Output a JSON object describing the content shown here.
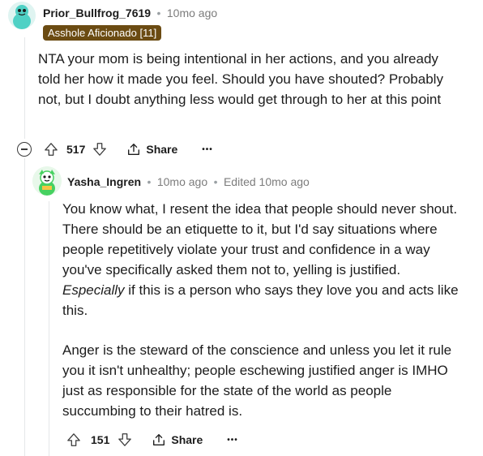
{
  "comment1": {
    "username": "Prior_Bullfrog_7619",
    "time": "10mo ago",
    "flair": "Asshole Aficionado [11]",
    "body": "NTA your mom is being intentional in her actions, and you already told her how it made you feel. Should you have shouted? Probably not, but I doubt anything less would get through to her at this point",
    "score": "517",
    "share_label": "Share",
    "more_label": "•••",
    "avatar_color": "#4fd1c5"
  },
  "comment2": {
    "username": "Yasha_Ingren",
    "time": "10mo ago",
    "edited": "Edited 10mo ago",
    "para1_pre": "You know what, I resent the idea that people should never shout. There should be an etiquette to it, but I'd say situations where people repetitively violate your trust and confidence in a way you've specifically asked them not to, yelling is justified.",
    "para1_em": "Especially",
    "para1_post": " if this is a person who says they love you and acts like this.",
    "para2": "Anger is the steward of the conscience and unless you let it rule you it isn't unhealthy; people eschewing justified anger is IMHO just as responsible for the state of the world as people succumbing to their hatred is.",
    "score": "151",
    "share_label": "Share",
    "more_label": "•••",
    "avatar_color": "#46d160"
  },
  "icons": {
    "upvote": "upvote-icon",
    "downvote": "downvote-icon",
    "share": "share-icon",
    "collapse": "collapse-icon"
  }
}
